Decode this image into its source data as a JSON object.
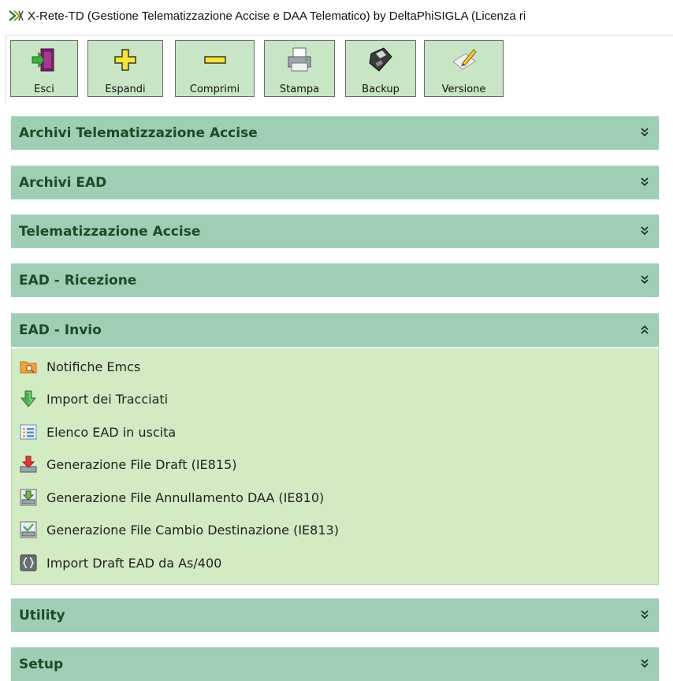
{
  "window": {
    "title": "X-Rete-TD  (Gestione Telematizzazione Accise e DAA Telematico) by DeltaPhiSIGLA (Licenza ri"
  },
  "toolbar": {
    "buttons": [
      {
        "label": "Esci",
        "icon": "exit-door-icon"
      },
      {
        "label": "Espandi",
        "icon": "plus-icon"
      },
      {
        "label": "Comprimi",
        "icon": "minus-icon"
      },
      {
        "label": "Stampa",
        "icon": "printer-icon"
      },
      {
        "label": "Backup",
        "icon": "floppy-disk-icon"
      },
      {
        "label": "Versione",
        "icon": "pencil-paper-icon"
      }
    ]
  },
  "panels": [
    {
      "label": "Archivi Telematizzazione Accise",
      "state": "collapsed"
    },
    {
      "label": "Archivi EAD",
      "state": "collapsed"
    },
    {
      "label": "Telematizzazione Accise",
      "state": "collapsed"
    },
    {
      "label": "EAD - Ricezione",
      "state": "collapsed"
    },
    {
      "label": "EAD - Invio",
      "state": "expanded",
      "items": [
        {
          "label": "Notifiche Emcs",
          "icon": "folder-search-icon"
        },
        {
          "label": "Import dei Tracciati",
          "icon": "download-arrow-icon"
        },
        {
          "label": "Elenco EAD in uscita",
          "icon": "list-icon"
        },
        {
          "label": "Generazione File Draft (IE815)",
          "icon": "tray-down-red-icon"
        },
        {
          "label": "Generazione File Annullamento DAA (IE810)",
          "icon": "tray-down-green-icon"
        },
        {
          "label": "Generazione File Cambio Destinazione (IE813)",
          "icon": "tray-check-icon"
        },
        {
          "label": "Import Draft EAD da As/400",
          "icon": "braces-icon"
        }
      ]
    },
    {
      "label": "Utility",
      "state": "collapsed"
    },
    {
      "label": "Setup",
      "state": "collapsed"
    }
  ],
  "colors": {
    "panel_header": "#9ecfb4",
    "panel_body": "#d2ebc3",
    "toolbar_button": "#c8e6c5",
    "header_text": "#1e4a24"
  }
}
